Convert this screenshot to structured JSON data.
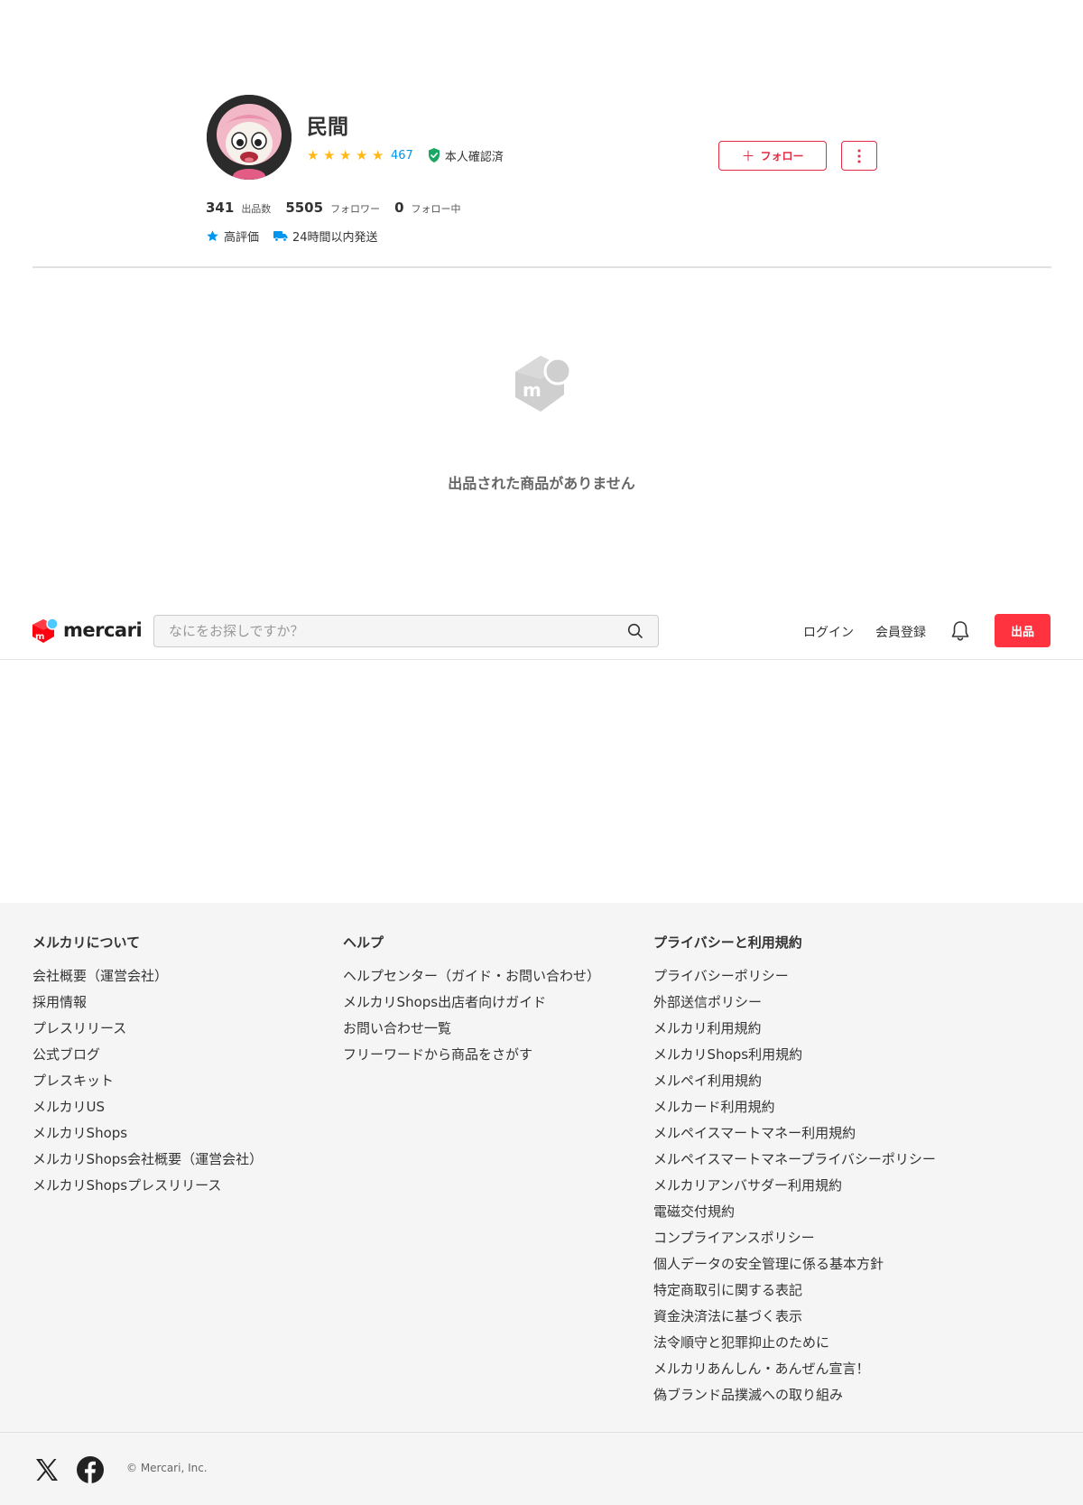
{
  "profile": {
    "name": "民間",
    "rating_stars": 5,
    "review_count": "467",
    "verified_label": "本人確認済",
    "follow_label": "フォロー",
    "stats": [
      {
        "value": "341",
        "label": "出品数"
      },
      {
        "value": "5505",
        "label": "フォロワー"
      },
      {
        "value": "0",
        "label": "フォロー中"
      }
    ],
    "badges": [
      {
        "icon": "star-icon",
        "label": "高評価"
      },
      {
        "icon": "truck-icon",
        "label": "24時間以内発送"
      }
    ]
  },
  "empty_state": {
    "message": "出品された商品がありません"
  },
  "header": {
    "logo_text": "mercari",
    "search_placeholder": "なにをお探しですか？",
    "login_label": "ログイン",
    "signup_label": "会員登録",
    "sell_label": "出品"
  },
  "footer": {
    "columns": [
      {
        "title": "メルカリについて",
        "links": [
          "会社概要（運営会社）",
          "採用情報",
          "プレスリリース",
          "公式ブログ",
          "プレスキット",
          "メルカリUS",
          "メルカリShops",
          "メルカリShops会社概要（運営会社）",
          "メルカリShopsプレスリリース"
        ]
      },
      {
        "title": "ヘルプ",
        "links": [
          "ヘルプセンター（ガイド・お問い合わせ）",
          "メルカリShops出店者向けガイド",
          "お問い合わせ一覧",
          "フリーワードから商品をさがす"
        ]
      },
      {
        "title": "プライバシーと利用規約",
        "links": [
          "プライバシーポリシー",
          "外部送信ポリシー",
          "メルカリ利用規約",
          "メルカリShops利用規約",
          "メルペイ利用規約",
          "メルカード利用規約",
          "メルペイスマートマネー利用規約",
          "メルペイスマートマネープライバシーポリシー",
          "メルカリアンバサダー利用規約",
          "電磁交付規約",
          "コンプライアンスポリシー",
          "個人データの安全管理に係る基本方針",
          "特定商取引に関する表記",
          "資金決済法に基づく表示",
          "法令順守と犯罪抑止のために",
          "メルカリあんしん・あんぜん宣言！",
          "偽ブランド品撲滅への取り組み"
        ]
      }
    ],
    "copyright": "© Mercari, Inc."
  },
  "colors": {
    "accent": "#ff333f",
    "follow_red": "#e42b45",
    "star": "#ffb818",
    "link_blue": "#0095ee",
    "verified_green": "#1aa763"
  }
}
